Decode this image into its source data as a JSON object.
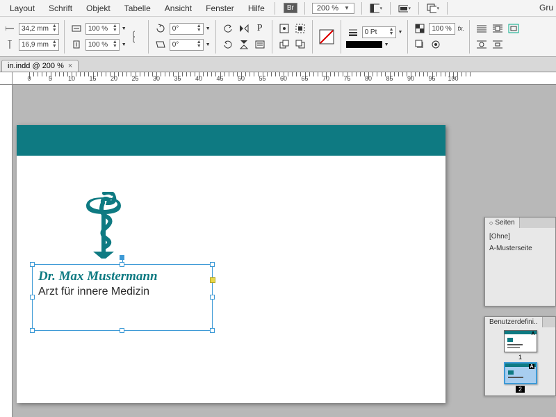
{
  "menu": {
    "items": [
      "Layout",
      "Schrift",
      "Objekt",
      "Tabelle",
      "Ansicht",
      "Fenster",
      "Hilfe"
    ],
    "bridge": "Br",
    "zoom": "200 %",
    "gru": "Gru"
  },
  "ruler": {
    "labels": [
      "0",
      "5",
      "10",
      "15",
      "20",
      "25",
      "30",
      "35",
      "40",
      "45",
      "50",
      "55",
      "60",
      "65",
      "70",
      "75",
      "80",
      "85",
      "90",
      "95",
      "100"
    ]
  },
  "toolbar": {
    "x": "34,2 mm",
    "y": "16,9 mm",
    "scaleX": "100 %",
    "scaleY": "100 %",
    "rotate": "0°",
    "shear": "0°",
    "strokeWeight": "0 Pt",
    "strokeOpacity": "100 %",
    "fx": "fx."
  },
  "tab": {
    "title": "in.indd @ 200 %"
  },
  "document": {
    "name_line": "Dr. Max Mustermann",
    "subtitle_line": "Arzt für innere Medizin"
  },
  "panels": {
    "pages": {
      "title": "Seiten",
      "none": "[Ohne]",
      "master": "A-Musterseite"
    },
    "user": {
      "title": "Benutzerdefini..",
      "thumb1_label": "1",
      "thumb2_label": "2"
    }
  }
}
